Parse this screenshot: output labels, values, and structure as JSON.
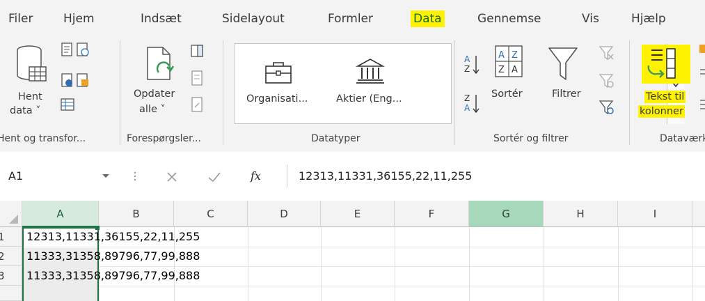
{
  "tabs": [
    {
      "label": "Filer"
    },
    {
      "label": "Hjem"
    },
    {
      "label": "Indsæt"
    },
    {
      "label": "Sidelayout"
    },
    {
      "label": "Formler"
    },
    {
      "label": "Data"
    },
    {
      "label": "Gennemse"
    },
    {
      "label": "Vis"
    },
    {
      "label": "Hjælp"
    }
  ],
  "active_tab": "Data",
  "ribbon": {
    "get_data": {
      "line1": "Hent",
      "line2": "data ˅"
    },
    "refresh": {
      "line1": "Opdater",
      "line2": "alle ˅"
    },
    "datatypes": {
      "organisation": "Organisati...",
      "stocks": "Aktier (Eng..."
    },
    "sort": {
      "label": "Sortér"
    },
    "filter": {
      "label": "Filtrer"
    },
    "text_to_columns": {
      "line1": "Tekst til",
      "line2": "kolonner"
    },
    "groups": {
      "get_transform": "Hent og transfor...",
      "queries": "Forespørgsler...",
      "datatypes": "Datatyper",
      "sort_filter": "Sortér og filtrer",
      "data_tools": "Dataværk"
    }
  },
  "formula_bar": {
    "name_box": "A1",
    "fx": "fx",
    "formula": "12313,11331,36155,22,11,255"
  },
  "grid": {
    "columns": [
      "A",
      "B",
      "C",
      "D",
      "E",
      "F",
      "G",
      "H",
      "I"
    ],
    "rows": [
      {
        "num": "1",
        "value": "12313,11331,36155,22,11,255"
      },
      {
        "num": "2",
        "value": "11333,31358,89796,77,99,888"
      },
      {
        "num": "3",
        "value": "11333,31358,89796,77,99,888"
      }
    ]
  },
  "colors": {
    "excel_green": "#217346",
    "highlight": "#fff200",
    "ribbon_bg": "#f3f3f3"
  }
}
